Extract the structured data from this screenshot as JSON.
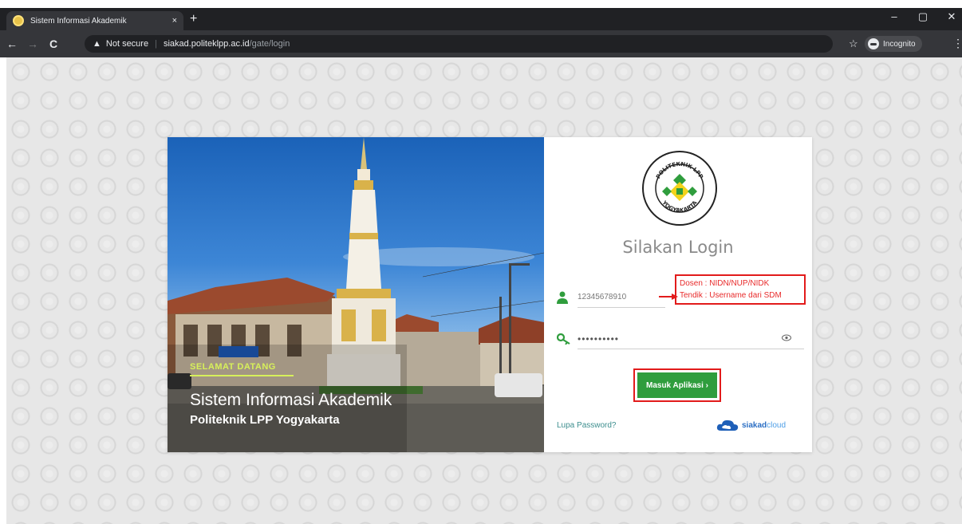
{
  "browser": {
    "tab_title": "Sistem Informasi Akademik",
    "tab_close": "×",
    "new_tab": "+",
    "window_controls": [
      "–",
      "▢",
      "✕"
    ],
    "nav": {
      "back": "←",
      "forward": "→",
      "reload": "C"
    },
    "security_label": "Not secure",
    "url_host": "siakad.politeklpp.ac.id",
    "url_path": "/gate/login",
    "star": "☆",
    "incognito_label": "Incognito",
    "menu": "⋮"
  },
  "hero": {
    "welcome": "SELAMAT DATANG",
    "title": "Sistem Informasi Akademik",
    "subtitle": "Politeknik LPP Yogyakarta"
  },
  "logo": {
    "text_top": "POLITEKNIK LPP",
    "text_bottom": "YOGYAKARTA"
  },
  "login": {
    "title": "Silakan Login",
    "username_value": "12345678910",
    "password_value": "••••••••••",
    "submit_label": "Masuk Aplikasi ›",
    "forgot_label": "Lupa Password?"
  },
  "annotation": {
    "line1": "Dosen : NIDN/NUP/NIDK",
    "line2": "Tendik : Username dari SDM"
  },
  "brand": {
    "name_primary": "siakad",
    "name_secondary": "cloud"
  },
  "colors": {
    "button_green": "#2f9d3d",
    "annotation_red": "#e21b1b",
    "logo_green": "#2f9d3d",
    "logo_yellow": "#f2d31b"
  }
}
